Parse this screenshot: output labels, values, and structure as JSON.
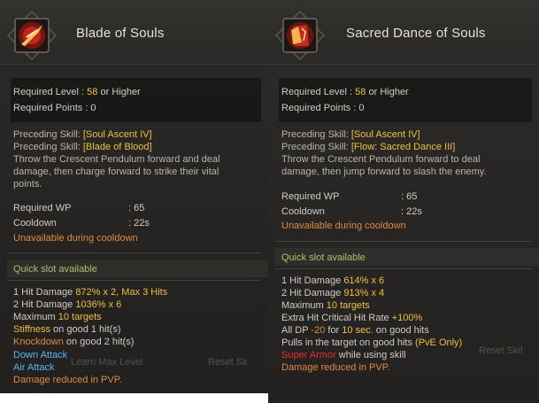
{
  "left": {
    "title": "Blade of Souls",
    "req_level_label": "Required Level : ",
    "req_level_value": "58",
    "req_level_suffix": " or Higher",
    "req_points": "Required Points : 0",
    "preceding_label": "Preceding Skill: ",
    "preceding_1": "[Soul Ascent IV]",
    "preceding_2": "[Blade of Blood]",
    "desc_1": "Throw the Crescent Pendulum forward and deal",
    "desc_2": "damage, then charge forward to strike their vital",
    "desc_3": "points.",
    "wp_label": "Required WP",
    "wp_value": ": 65",
    "cd_label": "Cooldown",
    "cd_value": ": 22s",
    "unavailable": "Unavailable during cooldown",
    "quick_slot": "Quick slot available",
    "hit1_a": "1 Hit Damage ",
    "hit1_b": "872% x 2, Max 3 Hits",
    "hit2_a": "2 Hit Damage ",
    "hit2_b": "1036% x 6",
    "max_a": "Maximum ",
    "max_b": "10 targets",
    "stiff_a": "Stiffness",
    "stiff_b": " on good 1 hit(s)",
    "knock_a": "Knockdown",
    "knock_b": " on good 2 hit(s)",
    "down_attack": "Down Attack",
    "air_attack": "Air Attack",
    "pvp": "Damage reduced in PVP.",
    "ghost_1": "Learn Max Level",
    "ghost_2": "Reset Sk"
  },
  "right": {
    "title": "Sacred Dance of Souls",
    "req_level_label": "Required Level : ",
    "req_level_value": "58",
    "req_level_suffix": " or Higher",
    "req_points": "Required Points : 0",
    "preceding_label": "Preceding Skill: ",
    "preceding_1": "[Soul Ascent IV]",
    "preceding_2": "[Flow: Sacred Dance III]",
    "desc_1": "Throw the Crescent Pendulum forward to deal",
    "desc_2": "damage, then jump forward to slash the enemy.",
    "wp_label": "Required WP",
    "wp_value": ": 65",
    "cd_label": "Cooldown",
    "cd_value": ": 22s",
    "unavailable": "Unavailable during cooldown",
    "quick_slot": "Quick slot available",
    "hit1_a": "1 Hit Damage ",
    "hit1_b": "614% x 6",
    "hit2_a": "2 Hit Damage ",
    "hit2_b": "913% x 4",
    "max_a": "Maximum ",
    "max_b": "10 targets",
    "crit_a": "Extra Hit Critical Hit Rate ",
    "crit_b": "+100%",
    "dp_a": "All DP ",
    "dp_b": "-20",
    "dp_c": " for ",
    "dp_d": "10 sec.",
    "dp_e": " on good hits",
    "pull_a": "Pulls in the target on good hits ",
    "pull_b": "(PvE Only)",
    "super_a": "Super Armor",
    "super_b": " while using skill",
    "pvp": "Damage reduced in PVP.",
    "ghost_1": "Reset Skil"
  },
  "colors": {
    "highlight": "#f0c030",
    "blue": "#5ab4f0",
    "orange": "#e08a3a",
    "red": "#ee2b2b",
    "green": "#a6c26a"
  },
  "icons": [
    "blade-of-souls-skill-icon",
    "sacred-dance-of-souls-skill-icon"
  ]
}
